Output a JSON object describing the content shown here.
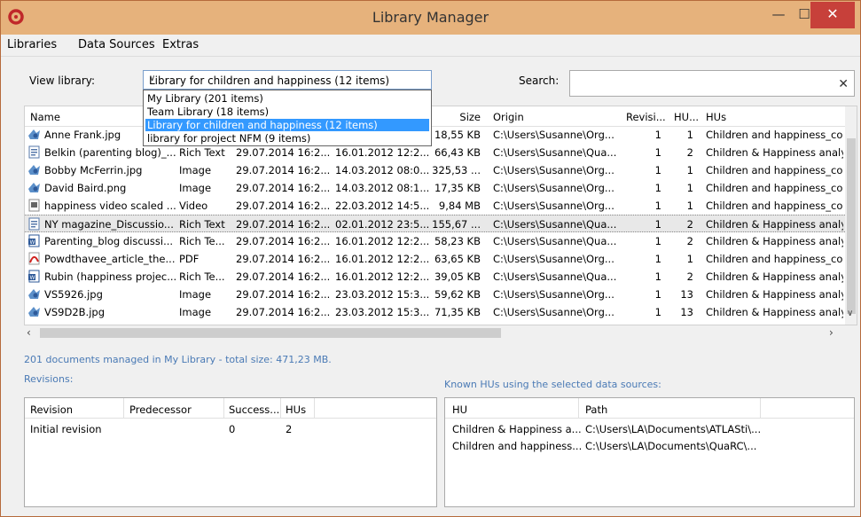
{
  "window": {
    "title": "Library Manager",
    "min": "—",
    "max": "☐",
    "close": "✕"
  },
  "menu": [
    "Libraries",
    "Data Sources",
    "Extras"
  ],
  "view_library": {
    "label": "View library:",
    "selected": "Library for children and happiness (12 items)",
    "options": [
      "My Library (201 items)",
      "Team Library (18 items)",
      "Library for children and happiness (12 items)",
      "library for project NFM (9 items)"
    ],
    "selected_index": 2
  },
  "search": {
    "label": "Search:",
    "value": "",
    "clear": "✕"
  },
  "grid": {
    "headers": {
      "name": "Name",
      "size": "Size",
      "origin": "Origin",
      "revisions": "Revisi...",
      "hus_count": "HU...",
      "hus": "HUs"
    },
    "rows": [
      {
        "icon": "image-icon",
        "name": "Anne Frank.jpg",
        "type": "",
        "imported": "",
        "modified": "",
        "size": "18,55 KB",
        "origin": "C:\\Users\\Susanne\\Org...",
        "rev": "1",
        "hucount": "1",
        "hus": "Children and happiness_code"
      },
      {
        "icon": "richtext-icon",
        "name": "Belkin (parenting blog)_...",
        "type": "Rich Text",
        "imported": "29.07.2014 16:2...",
        "modified": "16.01.2012 12:2...",
        "size": "66,43 KB",
        "origin": "C:\\Users\\Susanne\\Qua...",
        "rev": "1",
        "hucount": "2",
        "hus": "Children & Happiness analys"
      },
      {
        "icon": "image-icon",
        "name": "Bobby McFerrin.jpg",
        "type": "Image",
        "imported": "29.07.2014 16:2...",
        "modified": "14.03.2012 08:0...",
        "size": "325,53 ...",
        "origin": "C:\\Users\\Susanne\\Org...",
        "rev": "1",
        "hucount": "1",
        "hus": "Children and happiness_code"
      },
      {
        "icon": "image-icon",
        "name": "David Baird.png",
        "type": "Image",
        "imported": "29.07.2014 16:2...",
        "modified": "14.03.2012 08:1...",
        "size": "17,35 KB",
        "origin": "C:\\Users\\Susanne\\Org...",
        "rev": "1",
        "hucount": "1",
        "hus": "Children and happiness_code"
      },
      {
        "icon": "video-icon",
        "name": "happiness video scaled ...",
        "type": "Video",
        "imported": "29.07.2014 16:2...",
        "modified": "22.03.2012 14:5...",
        "size": "9,84 MB",
        "origin": "C:\\Users\\Susanne\\Org...",
        "rev": "1",
        "hucount": "1",
        "hus": "Children and happiness_code"
      },
      {
        "icon": "richtext-icon",
        "name": "NY magazine_Discussio...",
        "type": "Rich Text",
        "imported": "29.07.2014 16:2...",
        "modified": "02.01.2012 23:5...",
        "size": "155,67 ...",
        "origin": "C:\\Users\\Susanne\\Qua...",
        "rev": "1",
        "hucount": "2",
        "hus": "Children & Happiness analys"
      },
      {
        "icon": "word-icon",
        "name": "Parenting_blog discussi...",
        "type": "Rich Te...",
        "imported": "29.07.2014 16:2...",
        "modified": "16.01.2012 12:2...",
        "size": "58,23 KB",
        "origin": "C:\\Users\\Susanne\\Qua...",
        "rev": "1",
        "hucount": "2",
        "hus": "Children & Happiness analys"
      },
      {
        "icon": "pdf-icon",
        "name": "Powdthavee_article_the...",
        "type": "PDF",
        "imported": "29.07.2014 16:2...",
        "modified": "16.01.2012 12:2...",
        "size": "63,65 KB",
        "origin": "C:\\Users\\Susanne\\Org...",
        "rev": "1",
        "hucount": "1",
        "hus": "Children and happiness_code"
      },
      {
        "icon": "word-icon",
        "name": "Rubin (happiness projec...",
        "type": "Rich Te...",
        "imported": "29.07.2014 16:2...",
        "modified": "16.01.2012 12:2...",
        "size": "39,05 KB",
        "origin": "C:\\Users\\Susanne\\Qua...",
        "rev": "1",
        "hucount": "2",
        "hus": "Children & Happiness analys"
      },
      {
        "icon": "image-icon",
        "name": "VS5926.jpg",
        "type": "Image",
        "imported": "29.07.2014 16:2...",
        "modified": "23.03.2012 15:3...",
        "size": "59,62 KB",
        "origin": "C:\\Users\\Susanne\\Org...",
        "rev": "1",
        "hucount": "13",
        "hus": "Children & Happiness analys"
      },
      {
        "icon": "image-icon",
        "name": "VS9D2B.jpg",
        "type": "Image",
        "imported": "29.07.2014 16:2...",
        "modified": "23.03.2012 15:3...",
        "size": "71,35 KB",
        "origin": "C:\\Users\\Susanne\\Org...",
        "rev": "1",
        "hucount": "13",
        "hus": "Children & Happiness analys"
      }
    ],
    "selected_row": 5
  },
  "status": "201 documents managed in My Library - total size: 471,23 MB.",
  "revisions": {
    "label": "Revisions:",
    "headers": {
      "revision": "Revision",
      "predecessor": "Predecessor",
      "successor": "Success...",
      "hus": "HUs"
    },
    "rows": [
      {
        "revision": "Initial revision",
        "predecessor": "",
        "successor": "0",
        "hus": "2"
      }
    ]
  },
  "known_hus": {
    "label": "Known HUs using the selected data sources:",
    "headers": {
      "hu": "HU",
      "path": "Path"
    },
    "rows": [
      {
        "hu": "Children & Happiness a...",
        "path": "C:\\Users\\LA\\Documents\\ATLASti\\..."
      },
      {
        "hu": "Children and happiness...",
        "path": "C:\\Users\\LA\\Documents\\QuaRC\\..."
      }
    ]
  },
  "colors": {
    "titlebar": "#e6b27c",
    "selection": "#3399ff",
    "status_text": "#4a7ab5",
    "close_button": "#c7403a"
  }
}
